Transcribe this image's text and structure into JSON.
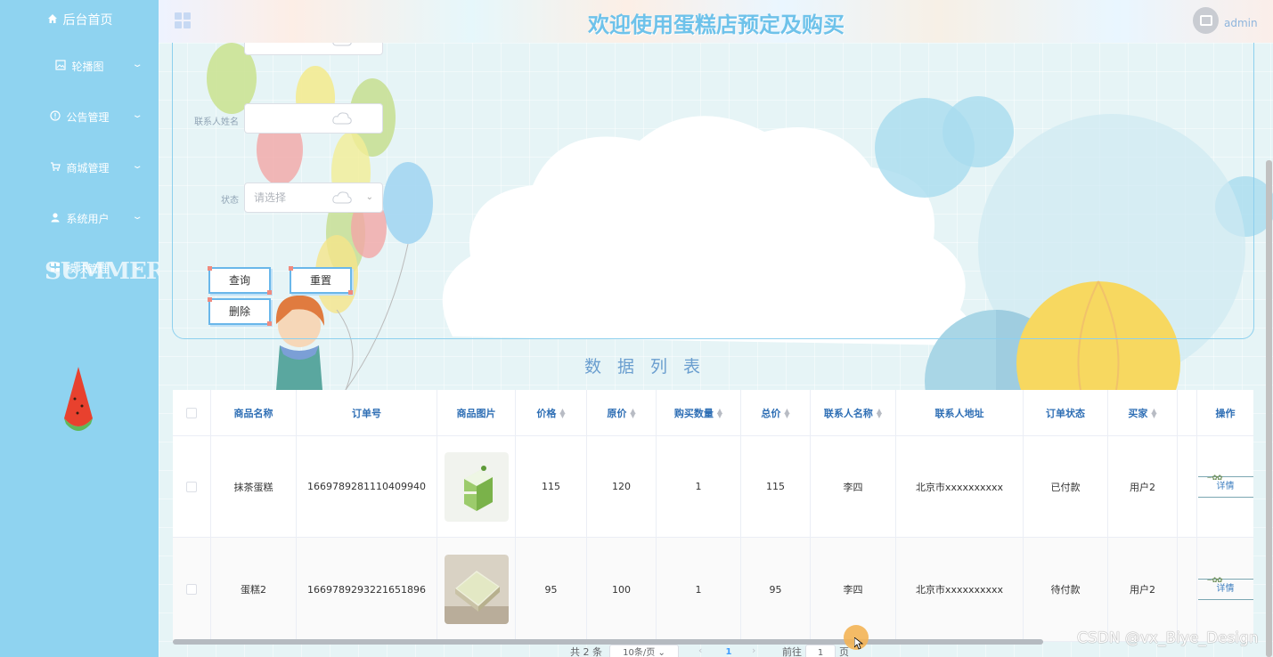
{
  "sidebar": {
    "items": [
      {
        "label": "后台首页",
        "icon": "home-icon"
      },
      {
        "label": "轮播图",
        "icon": "image-icon"
      },
      {
        "label": "公告管理",
        "icon": "info-icon"
      },
      {
        "label": "商城管理",
        "icon": "cart-icon"
      },
      {
        "label": "系统用户",
        "icon": "user-icon"
      },
      {
        "label": "模块管理",
        "icon": "grid-icon"
      }
    ],
    "decoration_text": "SUMMER"
  },
  "header": {
    "title": "欢迎使用蛋糕店预定及购买",
    "username": "admin"
  },
  "search": {
    "contact_label": "联系人姓名",
    "status_label": "状态",
    "status_placeholder": "请选择",
    "query_button": "查询",
    "reset_button": "重置",
    "delete_button": "删除"
  },
  "list_title": "数据列表",
  "table": {
    "columns": [
      "商品名称",
      "订单号",
      "商品图片",
      "价格",
      "原价",
      "购买数量",
      "总价",
      "联系人名称",
      "联系人地址",
      "订单状态",
      "买家",
      "操作"
    ],
    "rows": [
      {
        "name": "抹茶蛋糕",
        "order_no": "1669789281110409940",
        "price": "115",
        "original_price": "120",
        "quantity": "1",
        "total": "115",
        "contact": "李四",
        "address": "北京市xxxxxxxxxx",
        "status": "已付款",
        "buyer": "用户2",
        "action": "详情"
      },
      {
        "name": "蛋糕2",
        "order_no": "1669789293221651896",
        "price": "95",
        "original_price": "100",
        "quantity": "1",
        "total": "95",
        "contact": "李四",
        "address": "北京市xxxxxxxxxx",
        "status": "待付款",
        "buyer": "用户2",
        "action": "详情"
      }
    ]
  },
  "pagination": {
    "total_text": "共 2 条",
    "page_size": "10条/页",
    "current_page": "1",
    "goto_label": "前往",
    "goto_value": "1",
    "page_suffix": "页"
  },
  "watermark": "CSDN @vx_Biye_Design",
  "colors": {
    "sidebar_bg": "#8fd3f0",
    "title_color": "#6ec2ea",
    "header_text": "#2f6fb5"
  }
}
